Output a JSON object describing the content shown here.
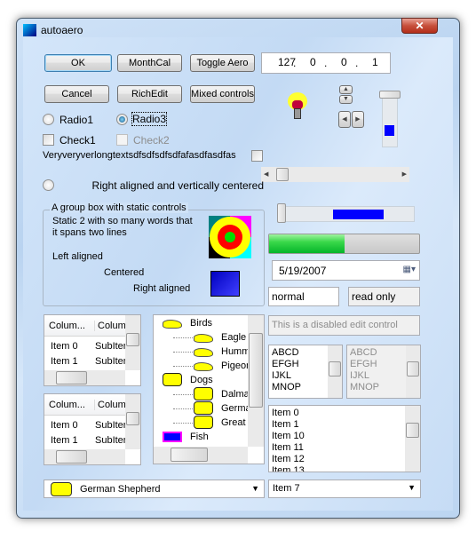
{
  "window": {
    "title": "autoaero",
    "close": "✕"
  },
  "buttons": {
    "ok": "OK",
    "monthcal": "MonthCal",
    "toggle_aero": "Toggle Aero",
    "cancel": "Cancel",
    "richedit": "RichEdit",
    "mixed": "Mixed controls"
  },
  "ip": [
    "127",
    "0",
    "0",
    "1"
  ],
  "radios": {
    "radio1": "Radio1",
    "radio3": "Radio3",
    "radio3_checked": true
  },
  "checks": {
    "check1": "Check1",
    "check2": "Check2"
  },
  "long_text": "Veryveryverlongtextsdfsdfsdfsdfafasdfasdfas",
  "right_aligned": "Right aligned and vertically centered",
  "group": {
    "title": "A group box with static controls",
    "static2": "Static 2 with so many words that it spans two lines",
    "left": "Left aligned",
    "centered": "Centered",
    "right": "Right aligned"
  },
  "progress": {
    "value": 50,
    "color": "#1ec42a"
  },
  "date": "5/19/2007",
  "edits": {
    "normal": "normal",
    "readonly": "read only",
    "disabled": "This is a disabled edit control"
  },
  "listbox_small": [
    "ABCD",
    "EFGH",
    "IJKL",
    "MNOP"
  ],
  "listbox_items": [
    "Item 0",
    "Item 1",
    "Item 10",
    "Item 11",
    "Item 12",
    "Item 13"
  ],
  "combo_right": "Item 7",
  "combo_left": "German Shepherd",
  "listview": {
    "columns": [
      "Colum...",
      "Column"
    ],
    "rows": [
      [
        "Item 0",
        "SubIten"
      ],
      [
        "Item 1",
        "SubIten"
      ]
    ]
  },
  "tree": {
    "nodes": [
      {
        "label": "Birds",
        "level": 0,
        "icon": "bird"
      },
      {
        "label": "Eagle",
        "level": 1,
        "icon": "bird"
      },
      {
        "label": "Humm",
        "level": 1,
        "icon": "bird"
      },
      {
        "label": "Pigeon",
        "level": 1,
        "icon": "bird"
      },
      {
        "label": "Dogs",
        "level": 0,
        "icon": "dog"
      },
      {
        "label": "Dalma",
        "level": 1,
        "icon": "dog"
      },
      {
        "label": "Germa",
        "level": 1,
        "icon": "dog"
      },
      {
        "label": "Great",
        "level": 1,
        "icon": "dog"
      },
      {
        "label": "Fish",
        "level": 0,
        "icon": "fish"
      }
    ]
  },
  "accent": "#0000ff"
}
